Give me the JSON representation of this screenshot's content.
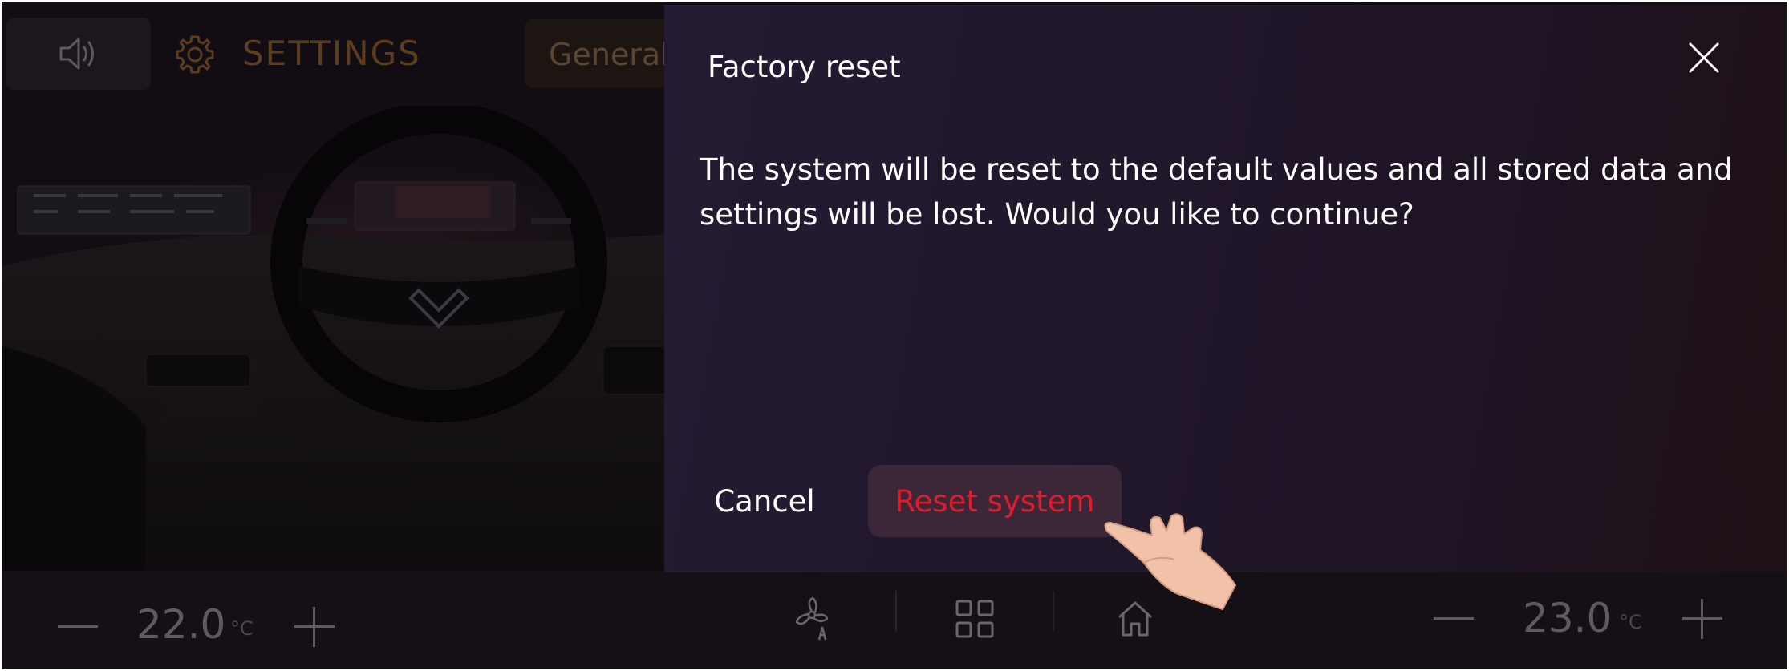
{
  "header": {
    "title": "SETTINGS",
    "tab_general": "General"
  },
  "dialog": {
    "title": "Factory reset",
    "message": "The system will be reset to the default values and all stored data and settings will be lost. Would you like to continue?",
    "cancel_label": "Cancel",
    "reset_label": "Reset system",
    "colors": {
      "reset_text": "#e11c2a",
      "reset_bg": "#3b2738"
    }
  },
  "climate": {
    "left_temp": "22.0",
    "right_temp": "23.0",
    "unit": "°C"
  },
  "icons": [
    "speaker-icon",
    "gear-icon",
    "close-icon",
    "fan-auto-icon",
    "apps-grid-icon",
    "home-icon",
    "minus-icon",
    "plus-icon",
    "pointing-hand-icon"
  ]
}
